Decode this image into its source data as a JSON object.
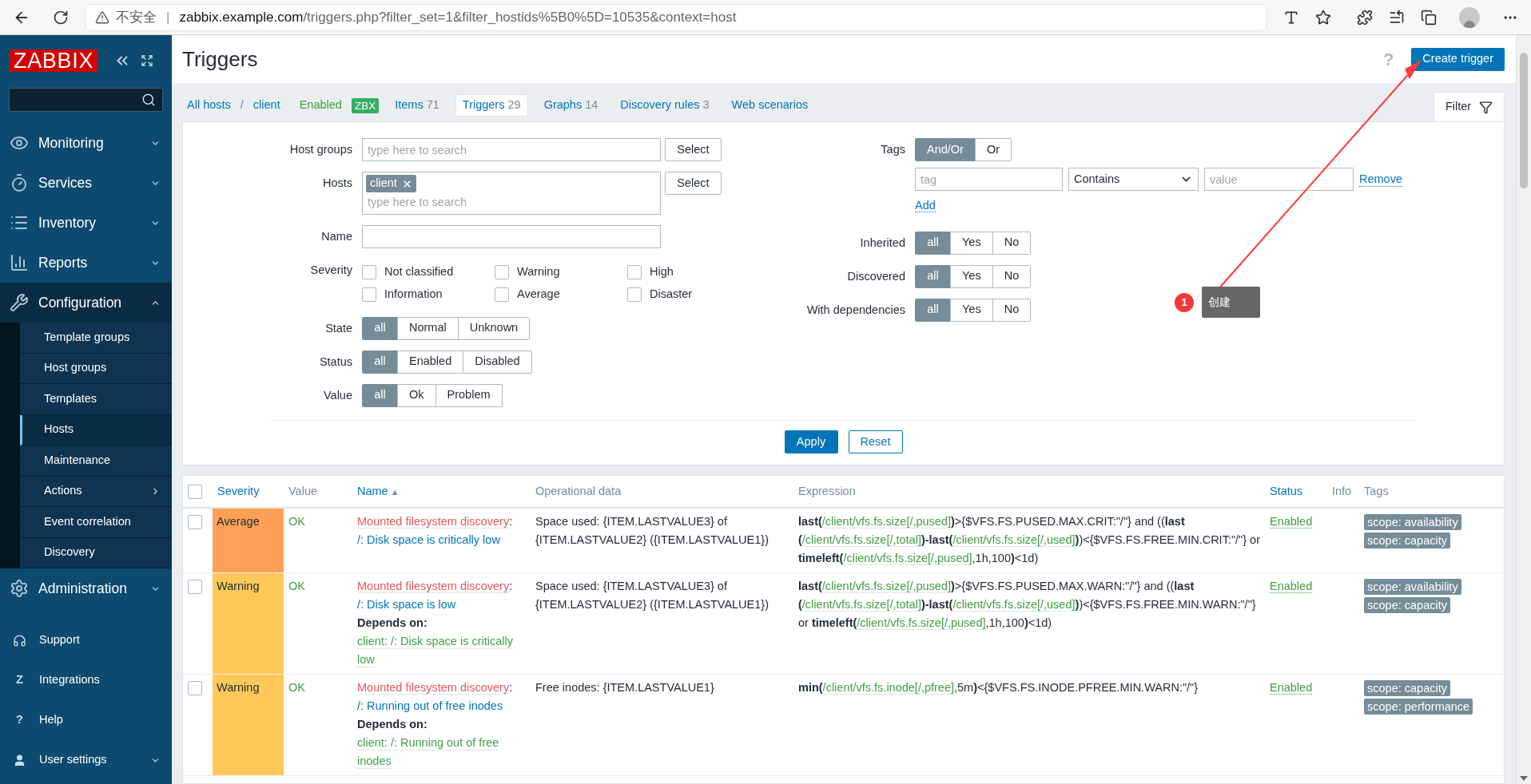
{
  "browser": {
    "warning": "不安全",
    "separator": "|",
    "host": "zabbix.example.com",
    "path": "/triggers.php?filter_set=1&filter_hostids%5B0%5D=10535&context=host"
  },
  "sidebar": {
    "logo": "ZABBIX",
    "menu": [
      {
        "label": "Monitoring",
        "expanded": false,
        "selected": false
      },
      {
        "label": "Services",
        "expanded": false,
        "selected": false
      },
      {
        "label": "Inventory",
        "expanded": false,
        "selected": false
      },
      {
        "label": "Reports",
        "expanded": false,
        "selected": false
      },
      {
        "label": "Configuration",
        "expanded": true,
        "selected": true,
        "children": [
          {
            "label": "Template groups",
            "selected": false,
            "submenu": false
          },
          {
            "label": "Host groups",
            "selected": false,
            "submenu": false
          },
          {
            "label": "Templates",
            "selected": false,
            "submenu": false
          },
          {
            "label": "Hosts",
            "selected": true,
            "submenu": false
          },
          {
            "label": "Maintenance",
            "selected": false,
            "submenu": false
          },
          {
            "label": "Actions",
            "selected": false,
            "submenu": true
          },
          {
            "label": "Event correlation",
            "selected": false,
            "submenu": false
          },
          {
            "label": "Discovery",
            "selected": false,
            "submenu": false
          }
        ]
      },
      {
        "label": "Administration",
        "expanded": false,
        "selected": false
      }
    ],
    "footer": [
      {
        "label": "Support",
        "kind": "headset"
      },
      {
        "label": "Integrations",
        "kind": "glyph",
        "glyph": "Z"
      },
      {
        "label": "Help",
        "kind": "glyph",
        "glyph": "?"
      },
      {
        "label": "User settings",
        "kind": "user",
        "expanded": false
      }
    ]
  },
  "header": {
    "title": "Triggers",
    "help": "?",
    "create_button": "Create trigger"
  },
  "breadcrumbs": {
    "all_hosts": "All hosts",
    "separator": "/",
    "host": "client",
    "status": "Enabled",
    "badge": "ZBX",
    "tabs": [
      {
        "label": "Items",
        "count": "71",
        "selected": false
      },
      {
        "label": "Triggers",
        "count": "29",
        "selected": true
      },
      {
        "label": "Graphs",
        "count": "14",
        "selected": false
      },
      {
        "label": "Discovery rules",
        "count": "3",
        "selected": false
      },
      {
        "label": "Web scenarios",
        "selected": false
      }
    ],
    "filter_tab": "Filter"
  },
  "filter": {
    "host_groups": {
      "label": "Host groups",
      "placeholder": "type here to search",
      "button": "Select"
    },
    "hosts": {
      "label": "Hosts",
      "chips": [
        "client"
      ],
      "placeholder": "type here to search",
      "button": "Select"
    },
    "name": {
      "label": "Name"
    },
    "severity": {
      "label": "Severity",
      "options": [
        {
          "label": "Not classified",
          "checked": false
        },
        {
          "label": "Warning",
          "checked": false
        },
        {
          "label": "High",
          "checked": false
        },
        {
          "label": "Information",
          "checked": false
        },
        {
          "label": "Average",
          "checked": false
        },
        {
          "label": "Disaster",
          "checked": false
        }
      ]
    },
    "left_groups": [
      {
        "label": "State",
        "options": [
          {
            "label": "all",
            "selected": true
          },
          {
            "label": "Normal",
            "selected": false
          },
          {
            "label": "Unknown",
            "selected": false
          }
        ]
      },
      {
        "label": "Status",
        "options": [
          {
            "label": "all",
            "selected": true
          },
          {
            "label": "Enabled",
            "selected": false
          },
          {
            "label": "Disabled",
            "selected": false
          }
        ]
      },
      {
        "label": "Value",
        "options": [
          {
            "label": "all",
            "selected": true
          },
          {
            "label": "Ok",
            "selected": false
          },
          {
            "label": "Problem",
            "selected": false
          }
        ]
      }
    ],
    "tags": {
      "label": "Tags",
      "options": [
        {
          "label": "And/Or",
          "selected": true
        },
        {
          "label": "Or",
          "selected": false
        }
      ],
      "tag_placeholder": "tag",
      "operator": "Contains",
      "value_placeholder": "value",
      "remove": "Remove",
      "add": "Add"
    },
    "right_groups": [
      {
        "label": "Inherited",
        "options": [
          {
            "label": "all",
            "selected": true
          },
          {
            "label": "Yes",
            "selected": false
          },
          {
            "label": "No",
            "selected": false
          }
        ]
      },
      {
        "label": "Discovered",
        "options": [
          {
            "label": "all",
            "selected": true
          },
          {
            "label": "Yes",
            "selected": false
          },
          {
            "label": "No",
            "selected": false
          }
        ]
      },
      {
        "label": "With dependencies",
        "options": [
          {
            "label": "all",
            "selected": true
          },
          {
            "label": "Yes",
            "selected": false
          },
          {
            "label": "No",
            "selected": false
          }
        ]
      }
    ],
    "apply": "Apply",
    "reset": "Reset"
  },
  "annotation": {
    "number": "1",
    "text": "创建"
  },
  "table": {
    "select_all_checked": false,
    "columns": [
      {
        "label": "Severity",
        "sortable": true
      },
      {
        "label": "Value",
        "sortable": false
      },
      {
        "label": "Name",
        "sortable": true,
        "sort_indicator": "▲"
      },
      {
        "label": "Operational data",
        "sortable": false
      },
      {
        "label": "Expression",
        "sortable": false
      },
      {
        "label": "Status",
        "sortable": true
      },
      {
        "label": "Info",
        "sortable": false
      },
      {
        "label": "Tags",
        "sortable": false
      }
    ],
    "rows": [
      {
        "checked": false,
        "severity": "Average",
        "color": "#ffa059",
        "value": "OK",
        "prefix": "Mounted filesystem discovery",
        "separator": ":",
        "name": "/: Disk space is critically low",
        "operational_data": "Space used: {ITEM.LASTVALUE3} of {ITEM.LASTVALUE2} ({ITEM.LASTVALUE1})",
        "expression": [
          {
            "kind": "fn",
            "text": "last("
          },
          {
            "kind": "link",
            "text": "/client/vfs.fs.size[/,pused]"
          },
          {
            "kind": "fn",
            "text": ")"
          },
          {
            "kind": "plain",
            "text": ">{$VFS.FS.PUSED.MAX.CRIT:\"/\"} and (("
          },
          {
            "kind": "fn",
            "text": "last("
          },
          {
            "kind": "link",
            "text": "/client/vfs.fs.size[/,total]"
          },
          {
            "kind": "fn",
            "text": ")-last("
          },
          {
            "kind": "link",
            "text": "/client/vfs.fs.size[/,used]"
          },
          {
            "kind": "fn",
            "text": ")"
          },
          {
            "kind": "plain",
            "text": ")<{$VFS.FS.FREE.MIN.CRIT:\"/\"} or "
          },
          {
            "kind": "fn",
            "text": "timeleft("
          },
          {
            "kind": "link",
            "text": "/client/vfs.fs.size[/,pused]"
          },
          {
            "kind": "plain",
            "text": ",1h,100"
          },
          {
            "kind": "fn",
            "text": ")"
          },
          {
            "kind": "plain",
            "text": "<1d)"
          }
        ],
        "status": "Enabled",
        "tags": [
          "scope: availability",
          "scope: capacity"
        ]
      },
      {
        "checked": false,
        "severity": "Warning",
        "color": "#ffc859",
        "value": "OK",
        "prefix": "Mounted filesystem discovery",
        "separator": ":",
        "name": "/: Disk space is low",
        "depends_label": "Depends on:",
        "depends": "client: /: Disk space is critically low",
        "operational_data": "Space used: {ITEM.LASTVALUE3} of {ITEM.LASTVALUE2} ({ITEM.LASTVALUE1})",
        "expression": [
          {
            "kind": "fn",
            "text": "last("
          },
          {
            "kind": "link",
            "text": "/client/vfs.fs.size[/,pused]"
          },
          {
            "kind": "fn",
            "text": ")"
          },
          {
            "kind": "plain",
            "text": ">{$VFS.FS.PUSED.MAX.WARN:\"/\"} and (("
          },
          {
            "kind": "fn",
            "text": "last("
          },
          {
            "kind": "link",
            "text": "/client/vfs.fs.size[/,total]"
          },
          {
            "kind": "fn",
            "text": ")-last("
          },
          {
            "kind": "link",
            "text": "/client/vfs.fs.size[/,used]"
          },
          {
            "kind": "fn",
            "text": ")"
          },
          {
            "kind": "plain",
            "text": ")<{$VFS.FS.FREE.MIN.WARN:\"/\"} or "
          },
          {
            "kind": "fn",
            "text": "timeleft("
          },
          {
            "kind": "link",
            "text": "/client/vfs.fs.size[/,pused]"
          },
          {
            "kind": "plain",
            "text": ",1h,100"
          },
          {
            "kind": "fn",
            "text": ")"
          },
          {
            "kind": "plain",
            "text": "<1d)"
          }
        ],
        "status": "Enabled",
        "tags": [
          "scope: availability",
          "scope: capacity"
        ]
      },
      {
        "checked": false,
        "severity": "Warning",
        "color": "#ffc859",
        "value": "OK",
        "prefix": "Mounted filesystem discovery",
        "separator": ":",
        "name": "/: Running out of free inodes",
        "depends_label": "Depends on:",
        "depends": "client: /: Running out of free inodes",
        "operational_data": "Free inodes: {ITEM.LASTVALUE1}",
        "expression": [
          {
            "kind": "fn",
            "text": "min("
          },
          {
            "kind": "link",
            "text": "/client/vfs.fs.inode[/,pfree]"
          },
          {
            "kind": "plain",
            "text": ",5m"
          },
          {
            "kind": "fn",
            "text": ")"
          },
          {
            "kind": "plain",
            "text": "<{$VFS.FS.INODE.PFREE.MIN.WARN:\"/\"}"
          }
        ],
        "status": "Enabled",
        "tags": [
          "scope: capacity",
          "scope: performance"
        ]
      }
    ]
  }
}
